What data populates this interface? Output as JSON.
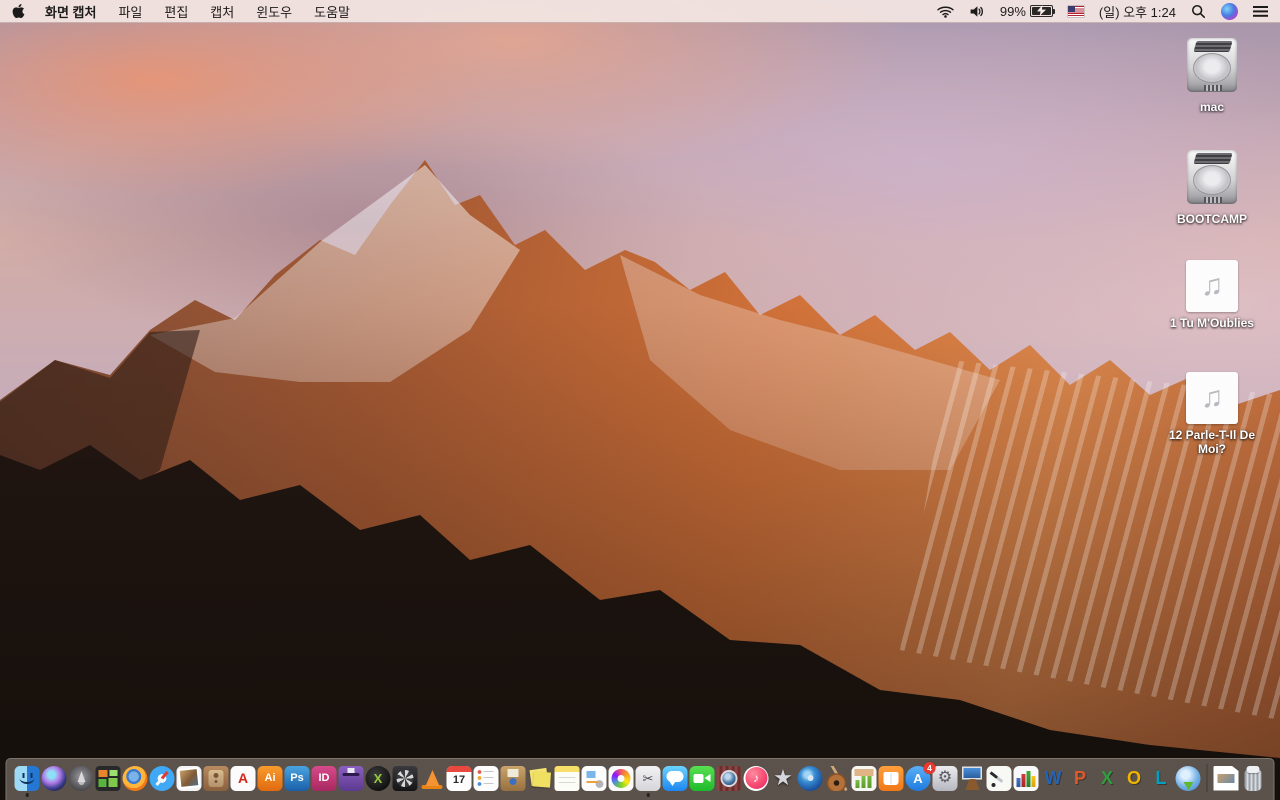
{
  "menubar": {
    "apple_icon": "apple-logo-icon",
    "app_name": "화면 캡처",
    "menus": [
      "파일",
      "편집",
      "캡처",
      "윈도우",
      "도움말"
    ],
    "status": {
      "wifi_icon": "wifi-icon",
      "volume_icon": "volume-icon",
      "battery_percent": "99%",
      "battery_icon": "battery-charging-icon",
      "input_flag_icon": "us-flag-icon",
      "clock": "(일) 오후 1:24",
      "spotlight_icon": "spotlight-search-icon",
      "siri_icon": "siri-icon",
      "notification_icon": "notification-center-icon"
    }
  },
  "desktop": {
    "audio_glyph": "♫",
    "icons": [
      {
        "name": "mac",
        "label": "mac",
        "type": "hard-drive"
      },
      {
        "name": "bootcamp",
        "label": "BOOTCAMP",
        "type": "hard-drive"
      },
      {
        "name": "tu-m-oublies",
        "label": "1 Tu M'Oublies",
        "type": "audio-file"
      },
      {
        "name": "parle-t-il-de-moi",
        "label": "12 Parle-T-Il De Moi?",
        "type": "audio-file"
      }
    ]
  },
  "dock": {
    "items": [
      {
        "name": "finder",
        "label": "Finder",
        "running": true
      },
      {
        "name": "siri",
        "label": "Siri"
      },
      {
        "name": "launchpad",
        "label": "Launchpad"
      },
      {
        "name": "mission-control",
        "label": "Mission Control"
      },
      {
        "name": "firefox",
        "label": "Firefox"
      },
      {
        "name": "safari",
        "label": "Safari"
      },
      {
        "name": "preview",
        "label": "Preview"
      },
      {
        "name": "contacts",
        "label": "Contacts"
      },
      {
        "name": "acrobat",
        "label": "Adobe Acrobat",
        "glyph": "A"
      },
      {
        "name": "illustrator",
        "label": "Adobe Illustrator",
        "glyph": "Ai"
      },
      {
        "name": "photoshop",
        "label": "Adobe Photoshop",
        "glyph": "Ps"
      },
      {
        "name": "indesign",
        "label": "Adobe InDesign",
        "glyph": "ID"
      },
      {
        "name": "toast",
        "label": "Toast"
      },
      {
        "name": "divx",
        "label": "DivX",
        "glyph": "X"
      },
      {
        "name": "black-drive",
        "label": "Drive Utility"
      },
      {
        "name": "vlc",
        "label": "VLC"
      },
      {
        "name": "calendar",
        "label": "Calendar",
        "glyph": "17"
      },
      {
        "name": "reminders",
        "label": "Reminders"
      },
      {
        "name": "stuffit",
        "label": "StuffIt Expander"
      },
      {
        "name": "stickies",
        "label": "Stickies"
      },
      {
        "name": "notes",
        "label": "Notes"
      },
      {
        "name": "textedit",
        "label": "TextEdit"
      },
      {
        "name": "photos",
        "label": "Photos"
      },
      {
        "name": "grab",
        "label": "화면 캡처",
        "glyph": "✂",
        "running": true
      },
      {
        "name": "messages",
        "label": "Messages"
      },
      {
        "name": "facetime",
        "label": "FaceTime"
      },
      {
        "name": "photo-booth",
        "label": "Photo Booth"
      },
      {
        "name": "itunes",
        "label": "iTunes",
        "glyph": "♪"
      },
      {
        "name": "imovie",
        "label": "iMovie",
        "glyph": "★"
      },
      {
        "name": "idvd",
        "label": "iDVD"
      },
      {
        "name": "garageband",
        "label": "GarageBand"
      },
      {
        "name": "numbers09",
        "label": "Numbers"
      },
      {
        "name": "ibooks",
        "label": "iBooks"
      },
      {
        "name": "app-store",
        "label": "App Store",
        "glyph": "A",
        "badge": "4"
      },
      {
        "name": "system-prefs",
        "label": "System Preferences",
        "glyph": "⚙"
      },
      {
        "name": "keynote09",
        "label": "Keynote"
      },
      {
        "name": "pages09",
        "label": "Pages"
      },
      {
        "name": "ms-office",
        "label": "Microsoft Office"
      },
      {
        "name": "word",
        "label": "Microsoft Word",
        "glyph": "W"
      },
      {
        "name": "powerpoint",
        "label": "Microsoft PowerPoint",
        "glyph": "P"
      },
      {
        "name": "excel",
        "label": "Microsoft Excel",
        "glyph": "X"
      },
      {
        "name": "outlook",
        "label": "Microsoft Outlook",
        "glyph": "O"
      },
      {
        "name": "lync",
        "label": "Microsoft Lync",
        "glyph": "L"
      },
      {
        "name": "doc-connection",
        "label": "Document Connection"
      },
      {
        "type": "separator"
      },
      {
        "name": "document",
        "label": "Document",
        "type": "file"
      },
      {
        "name": "trash",
        "label": "Trash",
        "type": "trash"
      }
    ]
  }
}
